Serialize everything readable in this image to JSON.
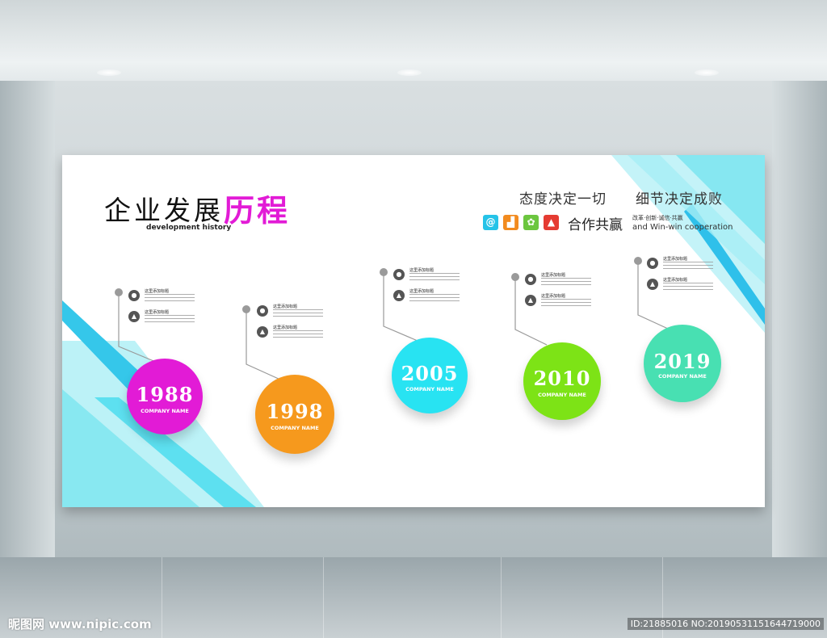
{
  "title": {
    "main": "企业发展",
    "accent": "历程",
    "subtitle": "development history"
  },
  "slogans": [
    "态度决定一切",
    "细节决定成败"
  ],
  "cooperation": {
    "zh": "合作共赢",
    "small": "改革·创新·诚信·共赢",
    "en": "and Win-win   cooperation"
  },
  "icons": [
    {
      "name": "at-icon",
      "glyph": "@",
      "color": "#25c3e8"
    },
    {
      "name": "chart-icon",
      "glyph": "▟",
      "color": "#f28b1f"
    },
    {
      "name": "flower-icon",
      "glyph": "✿",
      "color": "#6cc63f"
    },
    {
      "name": "person-icon",
      "glyph": "▲",
      "color": "#e53b32"
    }
  ],
  "milestones": [
    {
      "year": "1988",
      "company": "COMPANY NAME",
      "color": "#e21bd6"
    },
    {
      "year": "1998",
      "company": "COMPANY NAME",
      "color": "#f6991d"
    },
    {
      "year": "2005",
      "company": "COMPANY NAME",
      "color": "#28e3f2"
    },
    {
      "year": "2010",
      "company": "COMPANY NAME",
      "color": "#7de316"
    },
    {
      "year": "2019",
      "company": "COMPANY NAME",
      "color": "#48e0b2"
    }
  ],
  "info_title": "这里添加标题",
  "watermark": {
    "left": "昵图网 www.nipic.com",
    "right": "ID:21885016 NO:20190531151644719000"
  }
}
